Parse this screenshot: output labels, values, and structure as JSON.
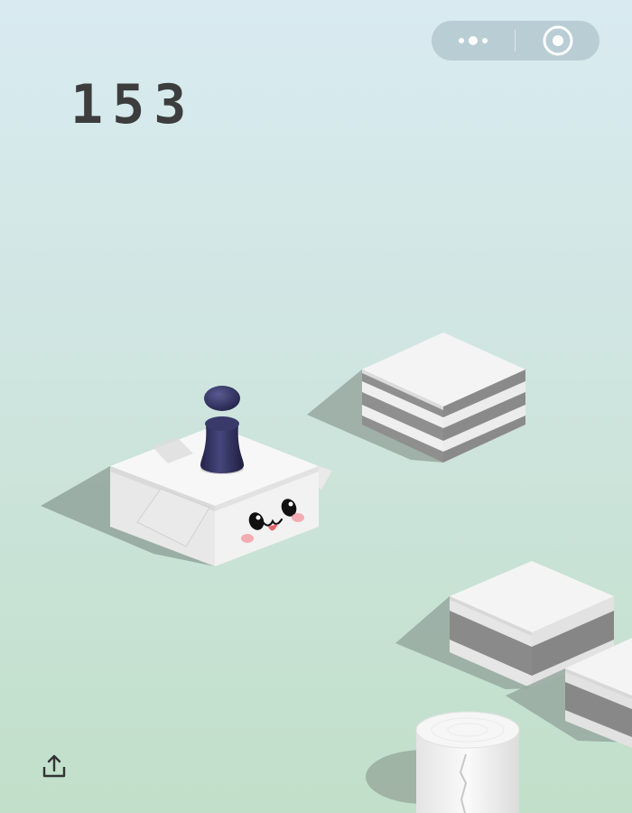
{
  "game": {
    "score": "153"
  },
  "icons": {
    "more": "more-dots-icon",
    "close": "target-circle-icon",
    "share": "share-upload-icon"
  },
  "colors": {
    "sky_top": "#d9ebf1",
    "ground_bottom": "#c1dfc9",
    "score_text": "#3d3d3d",
    "piece": "#2f2f5e",
    "block_top": "#f4f4f4",
    "stripe": "#8a8a8a"
  }
}
